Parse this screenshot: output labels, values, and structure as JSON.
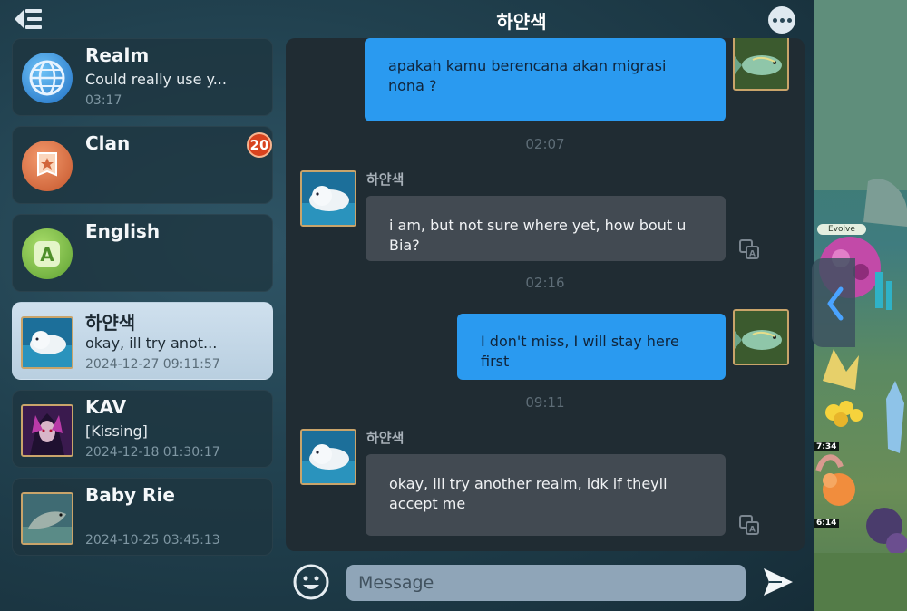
{
  "header": {
    "title": "하얀색",
    "back_icon": "back-list-icon",
    "more_icon": "more-dots-icon"
  },
  "conversations": [
    {
      "name": "Realm",
      "preview": "Could really use y...",
      "time": "03:17",
      "avatar": "globe-icon"
    },
    {
      "name": "Clan",
      "preview": "",
      "time": "",
      "badge": "20",
      "avatar": "shield-banner-icon"
    },
    {
      "name": "English",
      "preview": "",
      "time": "",
      "avatar": "letter-a-icon"
    },
    {
      "name": "하얀색",
      "preview": "okay, ill try anot...",
      "time": "2024-12-27 09:11:57",
      "avatar": "beluga-avatar",
      "active": true
    },
    {
      "name": "KAV",
      "preview": "[Kissing]",
      "time": "2024-12-18 01:30:17",
      "avatar": "character-avatar"
    },
    {
      "name": "Baby Rie",
      "preview": "",
      "time": "2024-10-25 03:45:13",
      "avatar": "seal-avatar"
    }
  ],
  "chat": {
    "messages": [
      {
        "type": "out",
        "text": "apakah kamu berencana akan migrasi nona ?"
      },
      {
        "type": "time",
        "text": "02:07"
      },
      {
        "type": "in",
        "sender": "하얀색",
        "text": "i am, but not sure where yet, how bout u Bia?"
      },
      {
        "type": "time",
        "text": "02:16"
      },
      {
        "type": "out",
        "text": "I don't miss, I will stay here first"
      },
      {
        "type": "time",
        "text": "09:11"
      },
      {
        "type": "in",
        "sender": "하얀색",
        "text": "okay, ill try another realm, idk if theyll accept me"
      }
    ]
  },
  "composer": {
    "placeholder": "Message",
    "emoji_icon": "smiley-icon",
    "send_icon": "send-arrow-icon"
  },
  "game": {
    "evolve_label": "Evolve",
    "timer_1": "7:34",
    "timer_2": "6:14",
    "side_tab_icon": "chevron-left-icon"
  },
  "colors": {
    "outgoing_bubble": "#2a9af0",
    "incoming_bubble": "#424a52",
    "badge": "#d8431f",
    "active_row": "#c4d8e8"
  }
}
